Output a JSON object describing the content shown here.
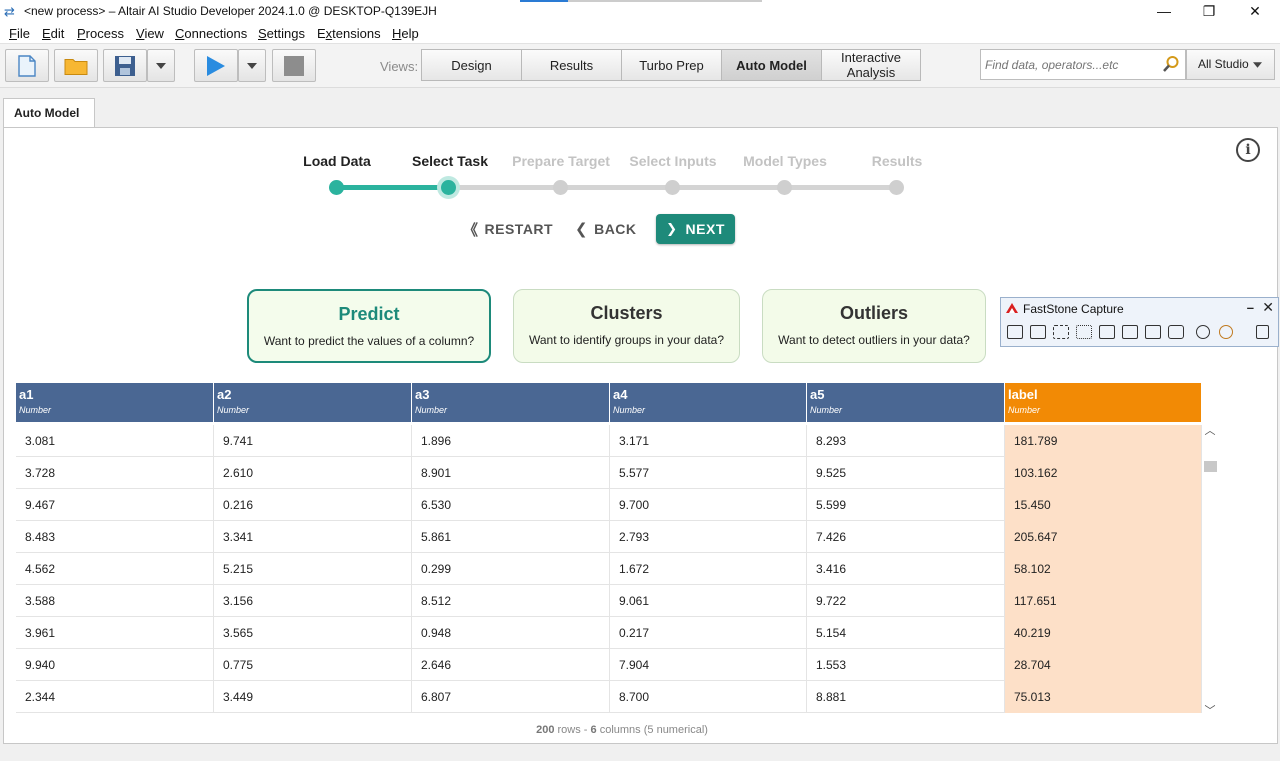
{
  "window": {
    "title": "<new process> – Altair AI Studio Developer 2024.1.0 @ DESKTOP-Q139EJH",
    "minimize": "—",
    "maximize": "❐",
    "close": "✕"
  },
  "menu": [
    {
      "label": "File",
      "key": "F"
    },
    {
      "label": "Edit",
      "key": "E"
    },
    {
      "label": "Process",
      "key": "P"
    },
    {
      "label": "View",
      "key": "V"
    },
    {
      "label": "Connections",
      "key": "C"
    },
    {
      "label": "Settings",
      "key": "S"
    },
    {
      "label": "Extensions",
      "key": "x"
    },
    {
      "label": "Help",
      "key": "H"
    }
  ],
  "toolbar": {
    "views_label": "Views:",
    "views": [
      "Design",
      "Results",
      "Turbo Prep",
      "Auto Model",
      "Interactive Analysis"
    ],
    "active_view": "Auto Model",
    "search_placeholder": "Find data, operators...etc",
    "studio_select": "All Studio"
  },
  "panel_tab": "Auto Model",
  "stepper": {
    "steps": [
      "Load Data",
      "Select Task",
      "Prepare Target",
      "Select Inputs",
      "Model Types",
      "Results"
    ],
    "current_index": 1,
    "accent": "#2bb39e"
  },
  "nav": {
    "restart": "RESTART",
    "back": "BACK",
    "next": "NEXT"
  },
  "tasks": [
    {
      "title": "Predict",
      "desc": "Want to predict the values of a column?",
      "selected": true
    },
    {
      "title": "Clusters",
      "desc": "Want to identify groups in your data?",
      "selected": false
    },
    {
      "title": "Outliers",
      "desc": "Want to detect outliers in your data?",
      "selected": false
    }
  ],
  "faststone": {
    "title": "FastStone Capture"
  },
  "table": {
    "columns": [
      {
        "name": "a1",
        "type": "Number"
      },
      {
        "name": "a2",
        "type": "Number"
      },
      {
        "name": "a3",
        "type": "Number"
      },
      {
        "name": "a4",
        "type": "Number"
      },
      {
        "name": "a5",
        "type": "Number"
      },
      {
        "name": "label",
        "type": "Number"
      }
    ],
    "rows": [
      [
        "3.081",
        "9.741",
        "1.896",
        "3.171",
        "8.293",
        "181.789"
      ],
      [
        "3.728",
        "2.610",
        "8.901",
        "5.577",
        "9.525",
        "103.162"
      ],
      [
        "9.467",
        "0.216",
        "6.530",
        "9.700",
        "5.599",
        "15.450"
      ],
      [
        "8.483",
        "3.341",
        "5.861",
        "2.793",
        "7.426",
        "205.647"
      ],
      [
        "4.562",
        "5.215",
        "0.299",
        "1.672",
        "3.416",
        "58.102"
      ],
      [
        "3.588",
        "3.156",
        "8.512",
        "9.061",
        "9.722",
        "117.651"
      ],
      [
        "3.961",
        "3.565",
        "0.948",
        "0.217",
        "5.154",
        "40.219"
      ],
      [
        "9.940",
        "0.775",
        "2.646",
        "7.904",
        "1.553",
        "28.704"
      ],
      [
        "2.344",
        "3.449",
        "6.807",
        "8.700",
        "8.881",
        "75.013"
      ]
    ]
  },
  "footer": {
    "rows_count": "200",
    "rows_word": "rows",
    "sep": "-",
    "cols_count": "6",
    "cols_text": "columns (5 numerical)"
  }
}
